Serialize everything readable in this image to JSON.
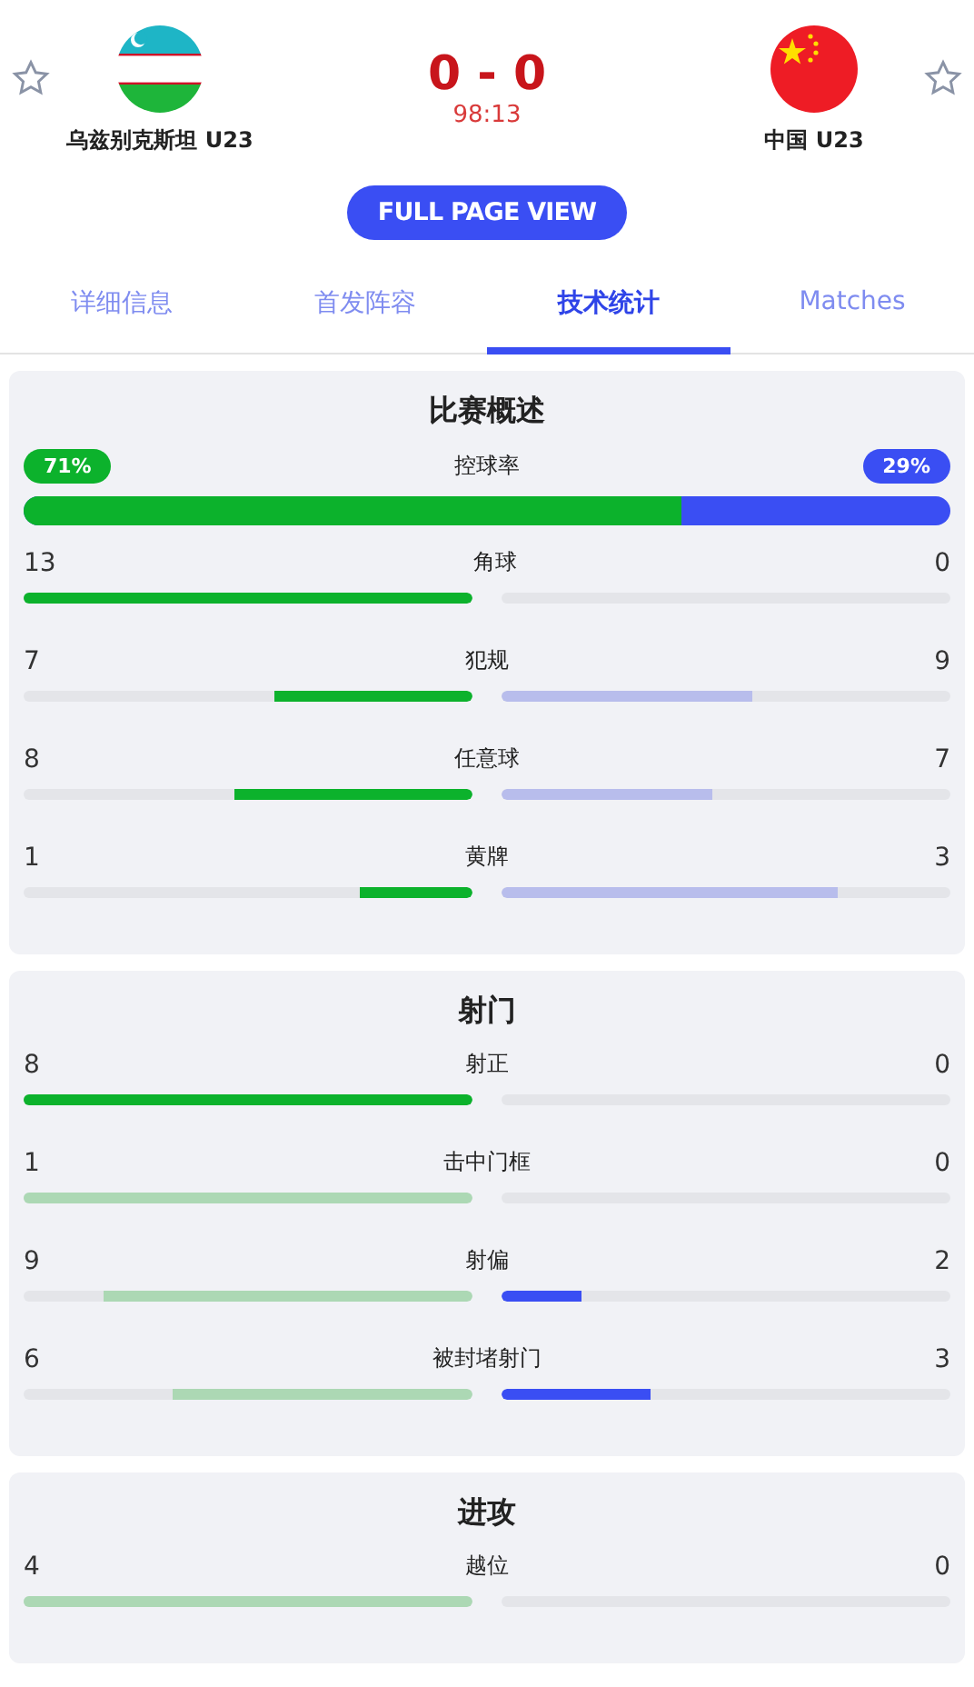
{
  "match": {
    "home": {
      "name": "乌兹别克斯坦 U23",
      "favorite": false
    },
    "away": {
      "name": "中国 U23",
      "favorite": false
    },
    "score": "0 - 0",
    "clock": "98:13"
  },
  "full_page_button": "FULL PAGE VIEW",
  "tabs": [
    {
      "label": "详细信息",
      "selected": false
    },
    {
      "label": "首发阵容",
      "selected": false
    },
    {
      "label": "技术统计",
      "selected": true
    },
    {
      "label": "Matches",
      "selected": false
    }
  ],
  "sections": [
    {
      "title": "比赛概述",
      "possession": {
        "label": "控球率",
        "home": "71%",
        "away": "29%",
        "level": 0.71
      },
      "rows": [
        {
          "label": "角球",
          "home": {
            "value": "13",
            "level": 1,
            "strong": true
          },
          "away": {
            "value": "0"
          }
        },
        {
          "label": "犯规",
          "home": {
            "value": "7",
            "level": 0.44,
            "strong": true
          },
          "away": {
            "value": "9",
            "level": 0.56,
            "strong": false
          }
        },
        {
          "label": "任意球",
          "home": {
            "value": "8",
            "level": 0.53,
            "strong": true
          },
          "away": {
            "value": "7",
            "level": 0.47,
            "strong": false
          }
        },
        {
          "label": "黄牌",
          "home": {
            "value": "1",
            "level": 0.25,
            "strong": true
          },
          "away": {
            "value": "3",
            "level": 0.75,
            "strong": false
          }
        }
      ]
    },
    {
      "title": "射门",
      "rows": [
        {
          "label": "射正",
          "home": {
            "value": "8",
            "level": 1,
            "strong": true
          },
          "away": {
            "value": "0"
          }
        },
        {
          "label": "击中门框",
          "home": {
            "value": "1",
            "level": 1,
            "strong": false
          },
          "away": {
            "value": "0"
          }
        },
        {
          "label": "射偏",
          "home": {
            "value": "9",
            "level": 0.82,
            "strong": false
          },
          "away": {
            "value": "2",
            "level": 0.18,
            "strong": true
          }
        },
        {
          "label": "被封堵射门",
          "home": {
            "value": "6",
            "level": 0.67,
            "strong": false
          },
          "away": {
            "value": "3",
            "level": 0.33,
            "strong": true
          }
        }
      ]
    },
    {
      "title": "进攻",
      "rows": [
        {
          "label": "越位",
          "home": {
            "value": "4",
            "level": 1,
            "strong": false
          },
          "away": {
            "value": "0"
          }
        }
      ]
    }
  ]
}
